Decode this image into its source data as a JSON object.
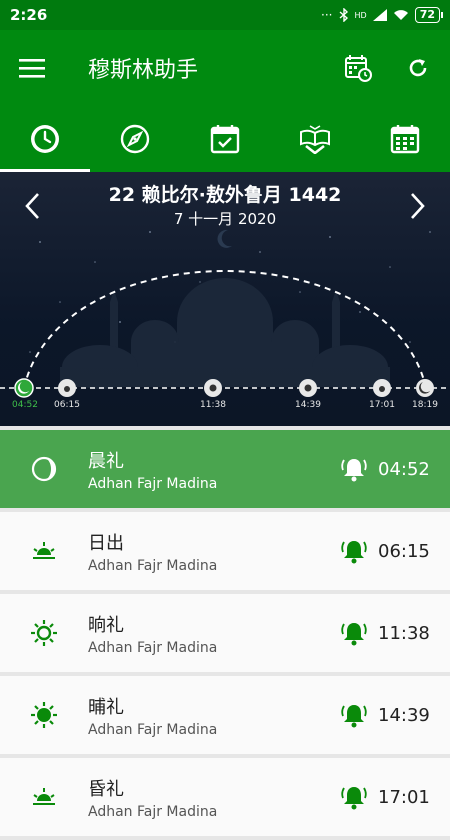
{
  "status": {
    "time": "2:26",
    "battery": "72",
    "signal": "HD"
  },
  "app": {
    "title": "穆斯林助手"
  },
  "tabs": [
    {
      "name": "clock-icon",
      "active": true
    },
    {
      "name": "compass-icon",
      "active": false
    },
    {
      "name": "calendar-check-icon",
      "active": false
    },
    {
      "name": "quran-icon",
      "active": false
    },
    {
      "name": "calendar-grid-icon",
      "active": false
    }
  ],
  "hero": {
    "hijri_date": "22 赖比尔·敖外鲁月 1442",
    "gregorian_date": "7 十一月 2020",
    "timeline": [
      "04:52",
      "06:15",
      "11:38",
      "14:39",
      "17:01",
      "18:19"
    ]
  },
  "prayers": [
    {
      "name": "晨礼",
      "sound": "Adhan Fajr Madina",
      "time": "04:52",
      "active": true
    },
    {
      "name": "日出",
      "sound": "Adhan Fajr Madina",
      "time": "06:15",
      "active": false
    },
    {
      "name": "晌礼",
      "sound": "Adhan Fajr Madina",
      "time": "11:38",
      "active": false
    },
    {
      "name": "晡礼",
      "sound": "Adhan Fajr Madina",
      "time": "14:39",
      "active": false
    },
    {
      "name": "昏礼",
      "sound": "Adhan Fajr Madina",
      "time": "17:01",
      "active": false
    }
  ],
  "colors": {
    "primary": "#008a10",
    "status": "#007a0e",
    "active_row": "#4aa54f",
    "accent": "#0a8a0a",
    "night": "#0c1729"
  }
}
